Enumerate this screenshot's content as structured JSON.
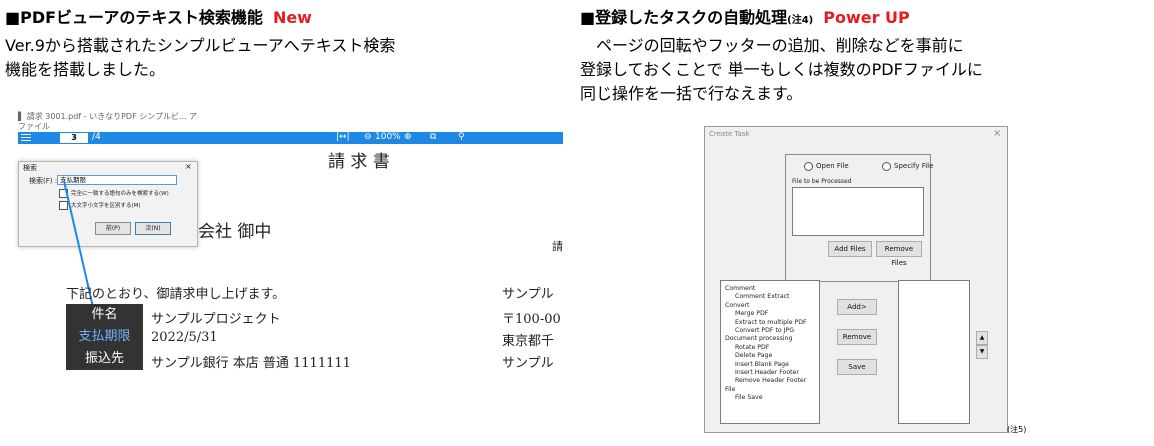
{
  "left": {
    "title": "■PDFビューアのテキスト検索機能",
    "tag": "New",
    "body_line1": "Ver.9から搭載されたシンプルビューアへテキスト検索",
    "body_line2": "機能を搭載しました。",
    "shot": {
      "title_bar": "▌ 請求 3001.pdf - いきなりPDF シンプルビ... ア",
      "menu": "ファイル",
      "page_current": "3",
      "page_total": "/4",
      "zoom": "100%",
      "search_dialog": {
        "title": "検索",
        "close": "×",
        "field_label": "検索(F) :",
        "field_value": "支払期限",
        "opt1": "完全に一致する語句のみを検索する(W)",
        "opt2": "大文字小文字を区別する(M)",
        "prev": "前(P)",
        "next": "次(N)"
      },
      "doc_title": "請 求 書",
      "company": "会社 御中",
      "edge_char": "請",
      "intro": "下記のとおり、御請求申し上げます。",
      "rows": [
        {
          "label": "件名",
          "value": "サンプルプロジェクト",
          "right": "〒100-00"
        },
        {
          "label": "支払期限",
          "value": "2022/5/31",
          "right": "東京都千"
        },
        {
          "label": "振込先",
          "value": "サンプル銀行 本店 普通 1111111",
          "right": "サンプル"
        }
      ],
      "right_top": "サンプル"
    }
  },
  "right": {
    "title": "■登録したタスクの自動処理",
    "note": "(注4)",
    "tag": "Power UP",
    "body_line1": "ページの回転やフッターの追加、削除などを事前に",
    "body_line2": "登録しておくことで 単一もしくは複数のPDFファイルに",
    "body_line3": "同じ操作を一括で行なえます。",
    "dialog": {
      "title": "Create Task",
      "close": "×",
      "open_file": "Open File",
      "specify_file": "Specify File",
      "file_label": "File to be Processed",
      "add_files": "Add Files",
      "remove_files": "Remove Files",
      "tree": [
        {
          "text": "Comment",
          "level": 0
        },
        {
          "text": "Comment Extract",
          "level": 1
        },
        {
          "text": "Convert",
          "level": 0
        },
        {
          "text": "Merge PDF",
          "level": 1
        },
        {
          "text": "Extract to multiple PDF",
          "level": 1
        },
        {
          "text": "Convert PDF to JPG",
          "level": 1
        },
        {
          "text": "Document processing",
          "level": 0
        },
        {
          "text": "Rotate PDF",
          "level": 1
        },
        {
          "text": "Delete Page",
          "level": 1
        },
        {
          "text": "Insert Blank Page",
          "level": 1
        },
        {
          "text": "Insert Header Footer",
          "level": 1
        },
        {
          "text": "Remove Header Footer",
          "level": 1
        },
        {
          "text": "File",
          "level": 0
        },
        {
          "text": "File Save",
          "level": 1
        }
      ],
      "add": "Add>",
      "remove": "Remove",
      "save": "Save",
      "up": "▲",
      "down": "▼"
    },
    "footnote": "(注5)"
  },
  "colors": {
    "accent": "#e01e24",
    "ribbon": "#1e88e5",
    "table_label": "#333333"
  }
}
